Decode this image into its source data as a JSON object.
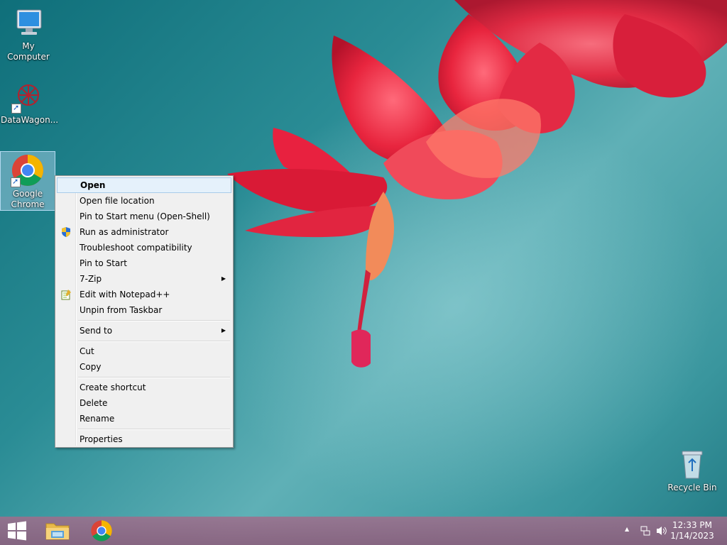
{
  "desktop": {
    "icons": [
      {
        "label": "My Computer",
        "icon": "computer-icon"
      },
      {
        "label": "DataWagon...",
        "icon": "datawagon-icon"
      },
      {
        "label": "Google\nChrome",
        "label_line1": "Google",
        "label_line2": "Chrome",
        "icon": "chrome-icon"
      },
      {
        "label": "Recycle Bin",
        "icon": "recycle-bin-icon"
      }
    ]
  },
  "context_menu": {
    "items": [
      {
        "label": "Open"
      },
      {
        "label": "Open file location"
      },
      {
        "label": "Pin to Start menu (Open-Shell)"
      },
      {
        "label": "Run as administrator",
        "icon": "uac-shield-icon"
      },
      {
        "label": "Troubleshoot compatibility"
      },
      {
        "label": "Pin to Start"
      },
      {
        "label": "7-Zip",
        "submenu": true
      },
      {
        "label": "Edit with Notepad++",
        "icon": "notepadpp-icon"
      },
      {
        "label": "Unpin from Taskbar"
      },
      {
        "label": "Send to",
        "submenu": true
      },
      {
        "label": "Cut"
      },
      {
        "label": "Copy"
      },
      {
        "label": "Create shortcut"
      },
      {
        "label": "Delete"
      },
      {
        "label": "Rename"
      },
      {
        "label": "Properties"
      }
    ],
    "submenu_arrow": "▶"
  },
  "taskbar": {
    "start": "windows-logo-icon",
    "pinned": [
      "file-explorer-icon",
      "chrome-icon"
    ],
    "tray": {
      "overflow": "▲",
      "time": "12:33 PM",
      "date": "1/14/2023"
    }
  },
  "colors": {
    "menu_bg": "#f0f0f0",
    "menu_highlight": "#e5f1fb",
    "taskbar": "#9a6a8a"
  }
}
